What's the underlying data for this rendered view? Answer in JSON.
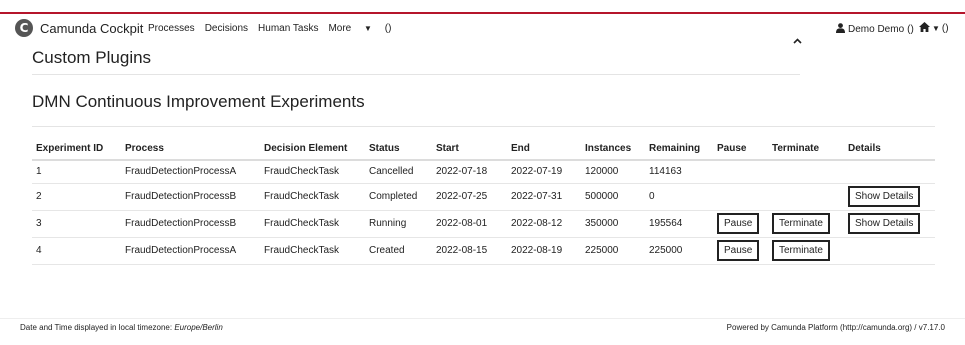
{
  "app": {
    "brand": "Camunda Cockpit",
    "logo_letter": "C",
    "accent_color": "#b5152b"
  },
  "nav": {
    "items": [
      "Processes",
      "Decisions",
      "Human Tasks"
    ],
    "more": "More",
    "more_suffix": "()"
  },
  "user": {
    "name": "Demo Demo",
    "suffix": "()"
  },
  "home": {
    "suffix": "()"
  },
  "sections": {
    "plugins_title": "Custom Plugins",
    "dmn_title": "DMN Continuous Improvement Experiments"
  },
  "table": {
    "headers": [
      "Experiment ID",
      "Process",
      "Decision Element",
      "Status",
      "Start",
      "End",
      "Instances",
      "Remaining",
      "Pause",
      "Terminate",
      "Details"
    ],
    "rows": [
      {
        "id": "1",
        "process": "FraudDetectionProcessA",
        "decision": "FraudCheckTask",
        "status": "Cancelled",
        "start": "2022-07-18",
        "end": "2022-07-19",
        "instances": "120000",
        "remaining": "114163",
        "pause": "",
        "terminate": "",
        "details": ""
      },
      {
        "id": "2",
        "process": "FraudDetectionProcessB",
        "decision": "FraudCheckTask",
        "status": "Completed",
        "start": "2022-07-25",
        "end": "2022-07-31",
        "instances": "500000",
        "remaining": "0",
        "pause": "",
        "terminate": "",
        "details": "Show Details"
      },
      {
        "id": "3",
        "process": "FraudDetectionProcessB",
        "decision": "FraudCheckTask",
        "status": "Running",
        "start": "2022-08-01",
        "end": "2022-08-12",
        "instances": "350000",
        "remaining": "195564",
        "pause": "Pause",
        "terminate": "Terminate",
        "details": "Show Details"
      },
      {
        "id": "4",
        "process": "FraudDetectionProcessA",
        "decision": "FraudCheckTask",
        "status": "Created",
        "start": "2022-08-15",
        "end": "2022-08-19",
        "instances": "225000",
        "remaining": "225000",
        "pause": "Pause",
        "terminate": "Terminate",
        "details": ""
      }
    ]
  },
  "footer": {
    "timezone_prefix": "Date and Time displayed in local timezone: ",
    "timezone": "Europe/Berlin",
    "powered_by": "Powered by Camunda Platform (http://camunda.org) / v7.17.0"
  }
}
